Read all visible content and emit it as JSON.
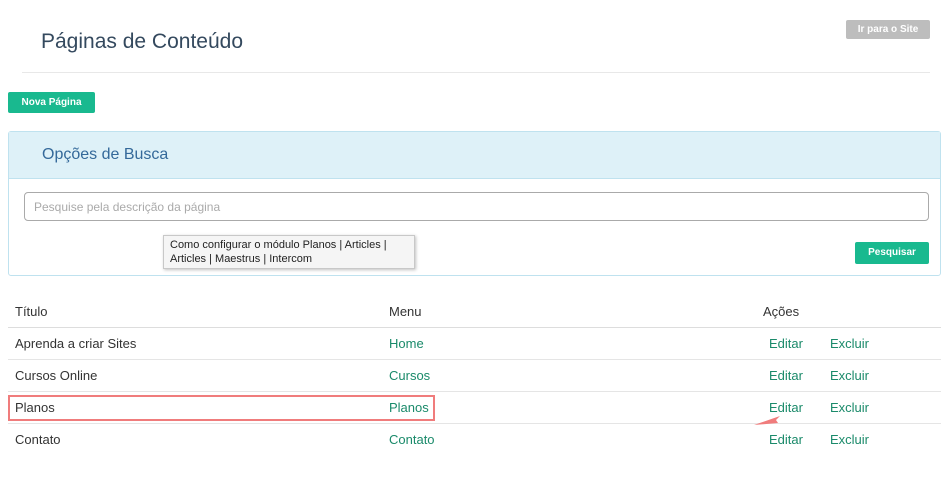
{
  "header": {
    "title": "Páginas de Conteúdo",
    "site_button_label": "Ir para o Site"
  },
  "toolbar": {
    "new_page_label": "Nova Página"
  },
  "search": {
    "title": "Opções de Busca",
    "placeholder": "Pesquise pela descrição da página",
    "button_label": "Pesquisar",
    "tooltip_line1": "Como configurar o módulo Planos | Articles |",
    "tooltip_line2": "Articles | Maestrus | Intercom"
  },
  "table": {
    "headers": {
      "title": "Título",
      "menu": "Menu",
      "actions": "Ações"
    },
    "edit_label": "Editar",
    "delete_label": "Excluir",
    "rows": [
      {
        "title": "Aprenda a criar Sites",
        "menu": "Home"
      },
      {
        "title": "Cursos Online",
        "menu": "Cursos"
      },
      {
        "title": "Planos",
        "menu": "Planos"
      },
      {
        "title": "Contato",
        "menu": "Contato"
      }
    ]
  },
  "colors": {
    "primary_green": "#19b98f",
    "link_green": "#1a8a6a",
    "panel_header_bg": "#def1f8",
    "highlight_red": "#f07c7c",
    "disabled_gray": "#bdbdbd"
  }
}
